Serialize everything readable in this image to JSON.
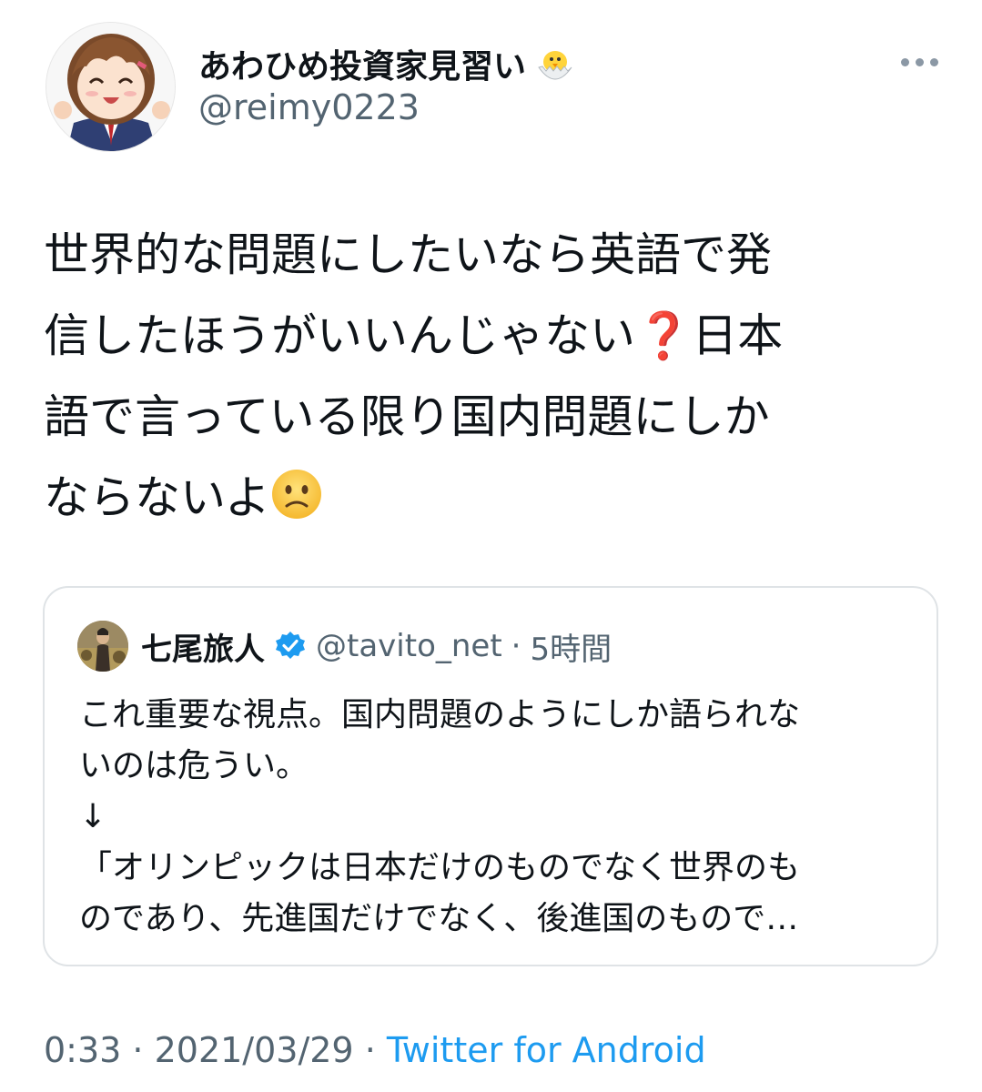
{
  "author": {
    "display_name": "あわひめ投資家見習い",
    "name_emoji_icon": "hatching-chick-icon",
    "handle": "@reimy0223"
  },
  "more_icon": "more-dots-icon",
  "tweet": {
    "line1": "世界的な問題にしたいなら英語で発",
    "line2_pre": "信したほうがいいんじゃない",
    "line2_qmark": "❓",
    "line2_post": "日本",
    "line3": "語で言っている限り国内問題にしか",
    "line4": "ならないよ",
    "end_emoji_icon": "slightly-frowning-face-icon"
  },
  "quote": {
    "name": "七尾旅人",
    "verified_icon": "verified-badge-icon",
    "handle": "@tavito_net",
    "separator": "·",
    "time": "5時間",
    "text": "これ重要な視点。国内問題のようにしか語られな\nいのは危うい。\n↓\n「オリンピックは日本だけのものでなく世界のも\nのであり、先進国だけでなく、後進国のもので…"
  },
  "meta": {
    "time": "0:33",
    "sep1": " · ",
    "date": "2021/03/29",
    "sep2": " · ",
    "source": "Twitter for Android"
  },
  "colors": {
    "text": "#0f1419",
    "secondary": "#536471",
    "link": "#1d9bf0",
    "verified": "#1d9bf0",
    "border": "#dfe3e6"
  }
}
